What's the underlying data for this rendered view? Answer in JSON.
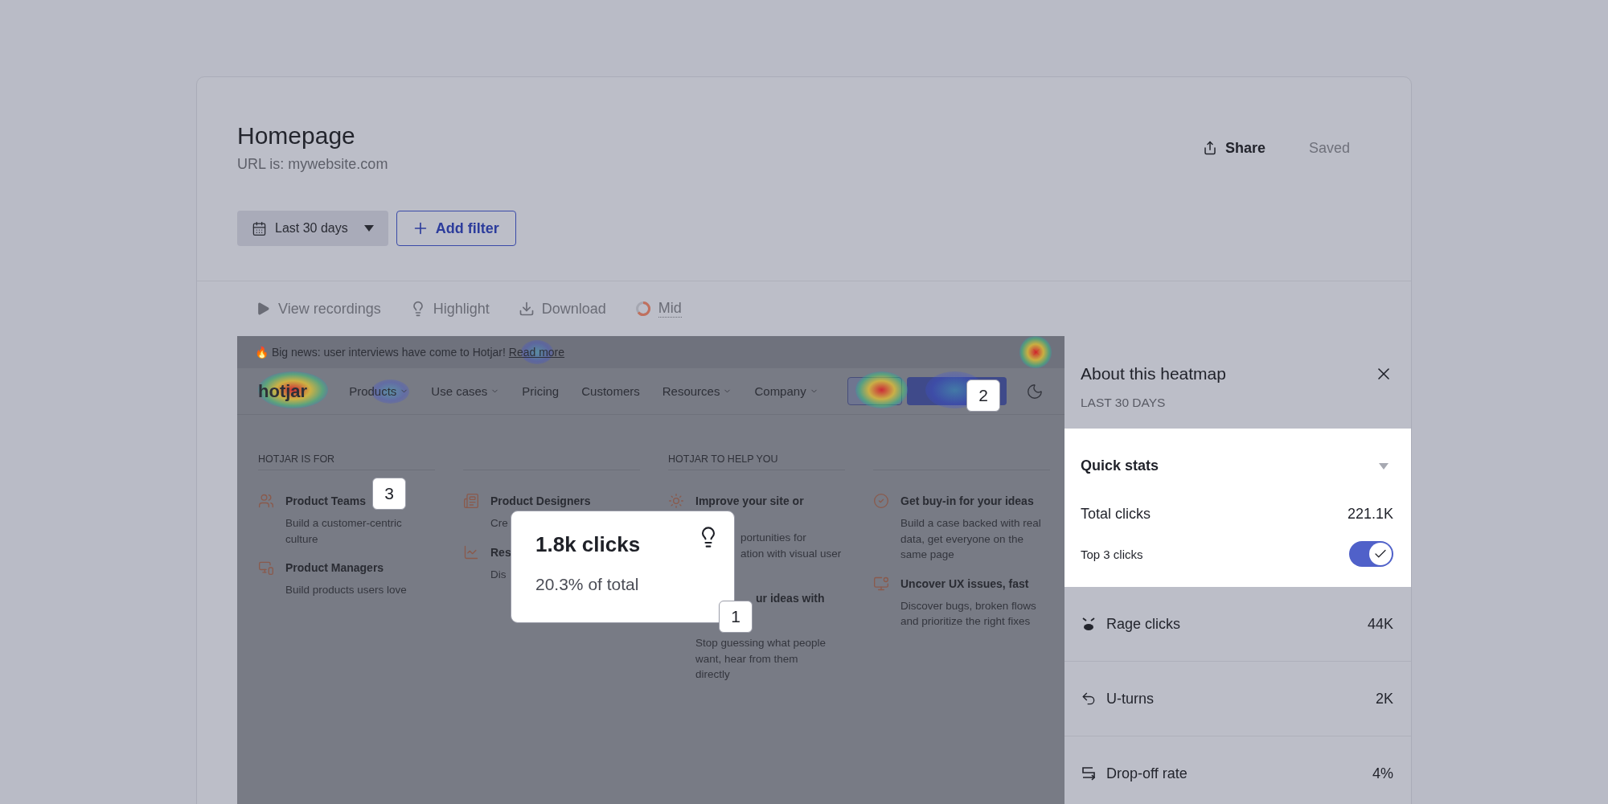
{
  "page": {
    "title": "Homepage",
    "url": "URL is: mywebsite.com"
  },
  "actions": [
    {
      "kind": "share",
      "label": "Share"
    },
    {
      "kind": "status",
      "label": "Saved"
    }
  ],
  "filters": {
    "date_range": "Last 30 days",
    "add_filter": "Add filter"
  },
  "toolbar": [
    {
      "kind": "play",
      "label": "View recordings"
    },
    {
      "kind": "bulb",
      "label": "Highlight"
    },
    {
      "kind": "download",
      "label": "Download"
    },
    {
      "kind": "progress",
      "label": "Mid"
    }
  ],
  "website": {
    "banner": {
      "emoji": "🔥",
      "text": "Big news: user interviews have come to Hotjar!",
      "link": "Read more"
    },
    "logo": "hotjar",
    "nav": [
      {
        "label": "Products",
        "dropdown": true
      },
      {
        "label": "Use cases",
        "dropdown": true
      },
      {
        "label": "Pricing",
        "dropdown": false
      },
      {
        "label": "Customers",
        "dropdown": false
      },
      {
        "label": "Resources",
        "dropdown": true
      },
      {
        "label": "Company",
        "dropdown": true
      }
    ],
    "sections": [
      {
        "heading": "HOTJAR IS FOR",
        "columns": [
          [
            {
              "kind": "plain",
              "title": "Product Teams",
              "lines": [
                "Build a customer-centric",
                "culture"
              ]
            },
            {
              "kind": "plain",
              "title": "Product Managers",
              "lines": [
                "Build products users love"
              ]
            }
          ],
          [
            {
              "kind": "plain",
              "title": "Product Designers",
              "lines": [
                "Cre"
              ]
            },
            {
              "kind": "plain",
              "title": "Res",
              "lines": [
                "Dis"
              ]
            }
          ]
        ]
      },
      {
        "heading": "HOTJAR TO HELP YOU",
        "columns": [
          [
            {
              "kind": "covered_description",
              "title": "Improve your site or",
              "lines": [
                "portunities for",
                "ation with visual user"
              ]
            },
            {
              "kind": "covered_title",
              "title": "ur ideas with",
              "lines": [
                "Stop guessing what people",
                "want, hear from them",
                "directly"
              ]
            }
          ],
          [
            {
              "kind": "plain",
              "title": "Get buy-in for your ideas",
              "lines": [
                "Build a case backed with real",
                "data, get everyone on the",
                "same page"
              ]
            },
            {
              "kind": "plain",
              "title": "Uncover UX issues, fast",
              "lines": [
                "Discover bugs, broken flows",
                "and prioritize the right fixes"
              ]
            }
          ]
        ]
      }
    ]
  },
  "tooltip": {
    "title": "1.8k clicks",
    "subtitle": "20.3% of total"
  },
  "markers": [
    "1",
    "2",
    "3"
  ],
  "panel": {
    "title": "About this heatmap",
    "subtitle": "LAST 30 DAYS",
    "quick_stats": {
      "title": "Quick stats",
      "expanded": true,
      "total_label": "Total clicks",
      "total_value": "221.1K",
      "toggle_label": "Top 3 clicks",
      "toggle_on": true
    },
    "metrics": [
      {
        "kind": "rage",
        "label": "Rage clicks",
        "value": "44K"
      },
      {
        "kind": "uturn",
        "label": "U-turns",
        "value": "2K"
      },
      {
        "kind": "dropoff",
        "label": "Drop-off rate",
        "value": "4%"
      }
    ]
  }
}
